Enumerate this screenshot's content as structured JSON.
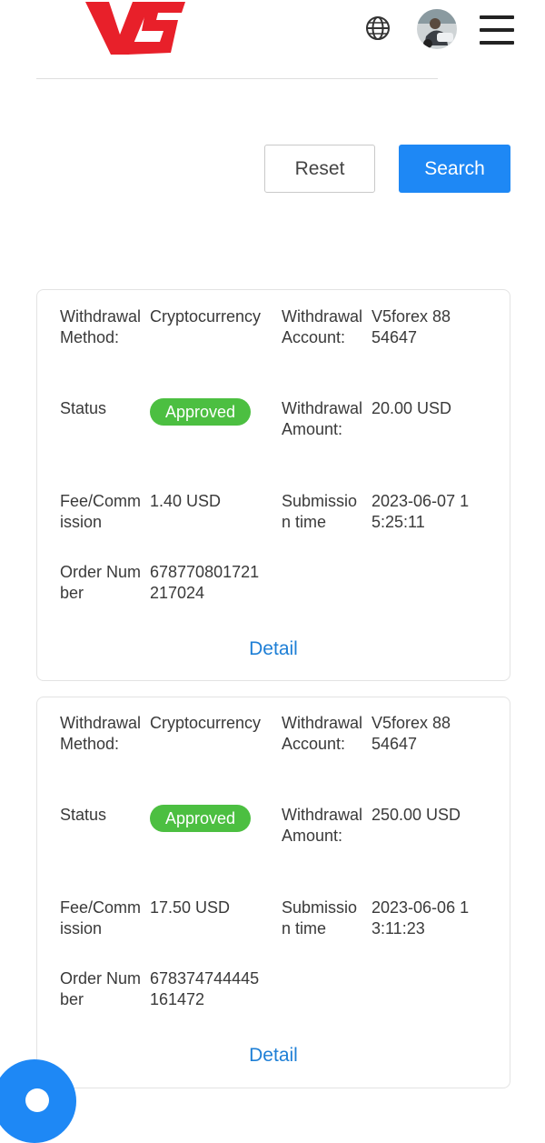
{
  "header": {
    "logo_text": "V5"
  },
  "filters": {
    "reset_label": "Reset",
    "search_label": "Search"
  },
  "records": [
    {
      "method_label": "Withdrawal Method:",
      "method": "Cryptocurrency",
      "account_label": "Withdrawal Account:",
      "account": "V5forex 8854647",
      "status_label": "Status",
      "status": "Approved",
      "amount_label": "Withdrawal Amount:",
      "amount": "20.00 USD",
      "fee_label": "Fee/Commission",
      "fee": "1.40 USD",
      "time_label": "Submission time",
      "time": "2023-06-07 15:25:11",
      "order_label": "Order Number",
      "order": "678770801721217024",
      "detail_label": "Detail"
    },
    {
      "method_label": "Withdrawal Method:",
      "method": "Cryptocurrency",
      "account_label": "Withdrawal Account:",
      "account": "V5forex 8854647",
      "status_label": "Status",
      "status": "Approved",
      "amount_label": "Withdrawal Amount:",
      "amount": "250.00 USD",
      "fee_label": "Fee/Commission",
      "fee": "17.50 USD",
      "time_label": "Submission time",
      "time": "2023-06-06 13:11:23",
      "order_label": "Order Number",
      "order": "678374744445161472",
      "detail_label": "Detail"
    }
  ],
  "colors": {
    "primary": "#1e88f5",
    "approved": "#4cbf41",
    "logo": "#e8202a"
  },
  "icons": {
    "language": "globe-icon",
    "menu": "hamburger-icon",
    "support": "chat-icon"
  }
}
